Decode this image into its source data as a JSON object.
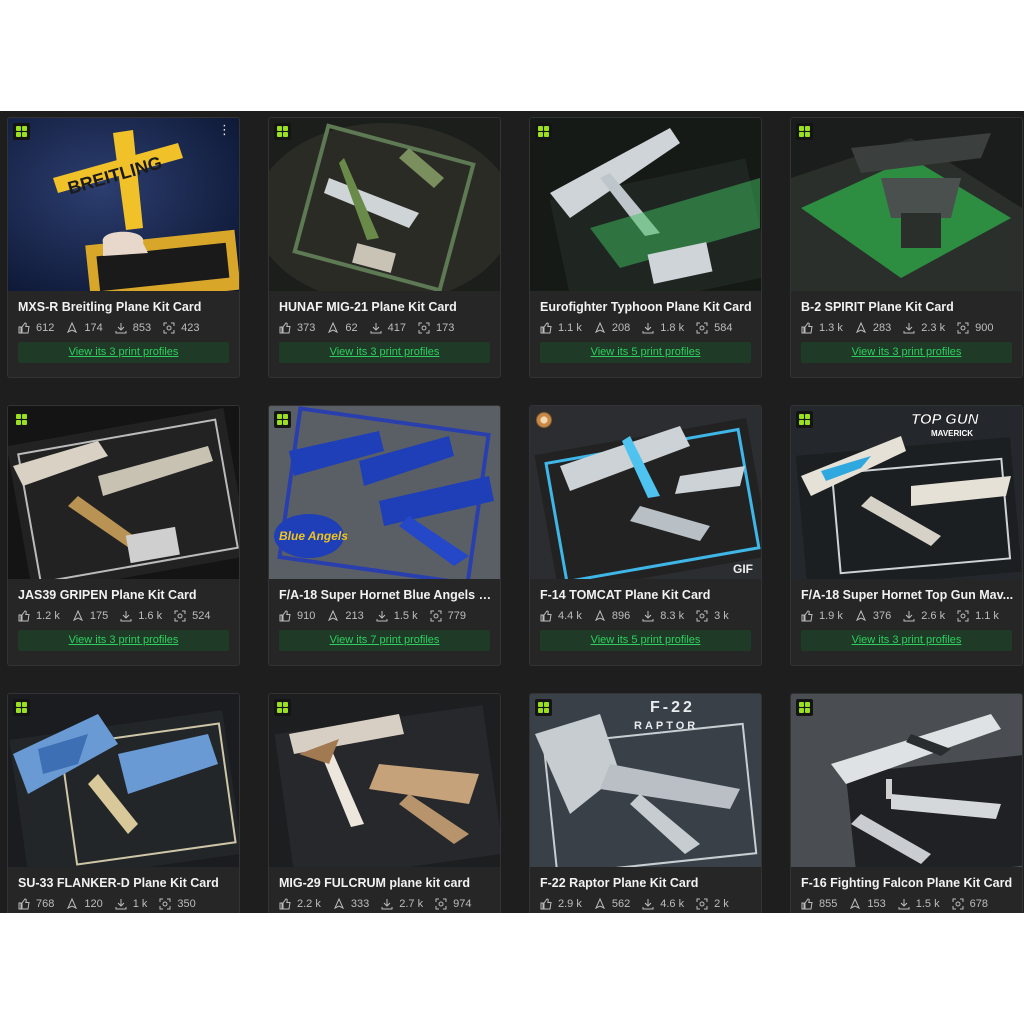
{
  "colors": {
    "accent_green": "#2ecf5e",
    "badge_green": "#9be01c",
    "card_bg": "#262626",
    "page_bg": "#1e1e1e"
  },
  "icons": {
    "likes": "thumbs-up-icon",
    "collects": "bookmark-icon",
    "downloads": "download-icon",
    "prints": "print-icon"
  },
  "cards": [
    {
      "title": "MXS-R Breitling Plane Kit Card",
      "likes": "612",
      "collects": "174",
      "downloads": "853",
      "prints": "423",
      "profiles": "View its 3 print profiles",
      "badge": "printables",
      "menu": "⋮",
      "gif": ""
    },
    {
      "title": "HUNAF MIG-21 Plane Kit Card",
      "likes": "373",
      "collects": "62",
      "downloads": "417",
      "prints": "173",
      "profiles": "View its 3 print profiles",
      "badge": "printables",
      "menu": "",
      "gif": ""
    },
    {
      "title": "Eurofighter Typhoon Plane Kit Card",
      "likes": "1.1 k",
      "collects": "208",
      "downloads": "1.8 k",
      "prints": "584",
      "profiles": "View its 5 print profiles",
      "badge": "printables",
      "menu": "",
      "gif": ""
    },
    {
      "title": "B-2 SPIRIT Plane Kit Card",
      "likes": "1.3 k",
      "collects": "283",
      "downloads": "2.3 k",
      "prints": "900",
      "profiles": "View its 3 print profiles",
      "badge": "printables",
      "menu": "",
      "gif": ""
    },
    {
      "title": "JAS39 GRIPEN Plane Kit Card",
      "likes": "1.2 k",
      "collects": "175",
      "downloads": "1.6 k",
      "prints": "524",
      "profiles": "View its 3 print profiles",
      "badge": "printables",
      "menu": "",
      "gif": ""
    },
    {
      "title": "F/A-18 Super Hornet Blue Angels P...",
      "likes": "910",
      "collects": "213",
      "downloads": "1.5 k",
      "prints": "779",
      "profiles": "View its 7 print profiles",
      "badge": "printables",
      "menu": "",
      "gif": ""
    },
    {
      "title": "F-14 TOMCAT Plane Kit Card",
      "likes": "4.4 k",
      "collects": "896",
      "downloads": "8.3 k",
      "prints": "3 k",
      "profiles": "View its 5 print profiles",
      "badge": "award",
      "menu": "",
      "gif": "GIF"
    },
    {
      "title": "F/A-18 Super Hornet Top Gun Mav...",
      "likes": "1.9 k",
      "collects": "376",
      "downloads": "2.6 k",
      "prints": "1.1 k",
      "profiles": "View its 3 print profiles",
      "badge": "printables",
      "menu": "",
      "gif": ""
    },
    {
      "title": "SU-33 FLANKER-D Plane Kit Card",
      "likes": "768",
      "collects": "120",
      "downloads": "1 k",
      "prints": "350",
      "profiles": "",
      "badge": "printables",
      "menu": "",
      "gif": ""
    },
    {
      "title": "MIG-29 FULCRUM plane kit card",
      "likes": "2.2 k",
      "collects": "333",
      "downloads": "2.7 k",
      "prints": "974",
      "profiles": "",
      "badge": "printables",
      "menu": "",
      "gif": ""
    },
    {
      "title": "F-22 Raptor Plane Kit Card",
      "likes": "2.9 k",
      "collects": "562",
      "downloads": "4.6 k",
      "prints": "2 k",
      "profiles": "",
      "badge": "printables",
      "menu": "",
      "gif": ""
    },
    {
      "title": "F-16 Fighting Falcon Plane Kit Card",
      "likes": "855",
      "collects": "153",
      "downloads": "1.5 k",
      "prints": "678",
      "profiles": "",
      "badge": "printables",
      "menu": "",
      "gif": ""
    }
  ],
  "thumb_text": {
    "c0_a": "BREITLING",
    "c2_a": "",
    "c5_a": "Blue Angels",
    "c7_a": "TOP GUN",
    "c7_b": "MAVERICK",
    "c10_a": "F-22",
    "c10_b": "RAPTOR"
  }
}
